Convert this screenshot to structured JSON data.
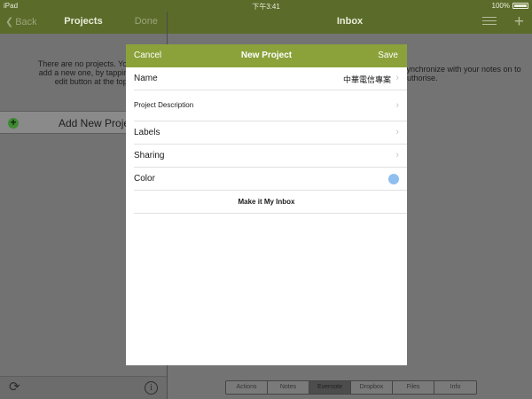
{
  "status_bar": {
    "device": "iPad",
    "time": "下午3:41",
    "battery": "100%"
  },
  "left_pane": {
    "back_label": "Back",
    "title": "Projects",
    "done_label": "Done",
    "empty_message": "There are no projects. You can add a new one, by tapping the edit button at the top.",
    "add_new_label": "Add New Project"
  },
  "right_pane": {
    "title": "Inbox",
    "message": "synchronize with your notes on to authorise.",
    "segments": [
      "Actions",
      "Notes",
      "Evernote",
      "Dropbox",
      "Files",
      "Info"
    ],
    "active_segment": "Evernote"
  },
  "modal": {
    "cancel_label": "Cancel",
    "title": "New Project",
    "save_label": "Save",
    "rows": {
      "name_label": "Name",
      "name_value": "中華電信專案",
      "description_label": "Project Description",
      "labels_label": "Labels",
      "sharing_label": "Sharing",
      "color_label": "Color",
      "inbox_label": "Make it My Inbox"
    },
    "color_value": "#8fbfef"
  },
  "colors": {
    "nav_bar": "#5b6b2a",
    "modal_header": "#8ba23a",
    "add_icon": "#3f8a33"
  }
}
